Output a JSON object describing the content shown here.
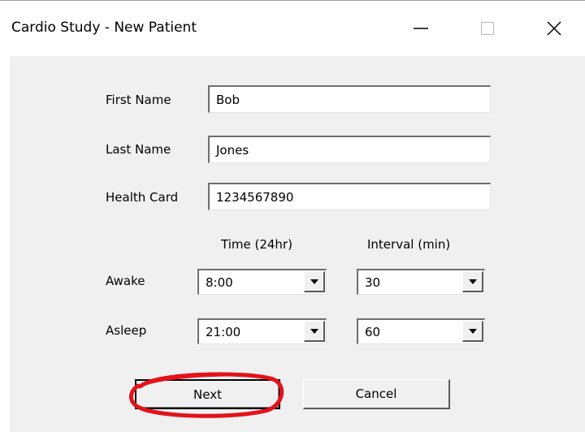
{
  "window": {
    "title": "Cardio Study - New Patient"
  },
  "titlebar": {
    "minimize_icon": "minimize-icon",
    "maximize_icon": "maximize-icon",
    "close_icon": "close-icon"
  },
  "form": {
    "first_name": {
      "label": "First Name",
      "value": "Bob"
    },
    "last_name": {
      "label": "Last Name",
      "value": "Jones"
    },
    "health_card": {
      "label": "Health Card",
      "value": "1234567890"
    },
    "time_header": "Time (24hr)",
    "interval_header": "Interval (min)",
    "awake": {
      "label": "Awake",
      "time": "8:00",
      "interval": "30"
    },
    "asleep": {
      "label": "Asleep",
      "time": "21:00",
      "interval": "60"
    }
  },
  "buttons": {
    "next_label": "Next",
    "cancel_label": "Cancel"
  },
  "colors": {
    "highlight": "#e3121b",
    "client_background": "#f0f0f0"
  }
}
